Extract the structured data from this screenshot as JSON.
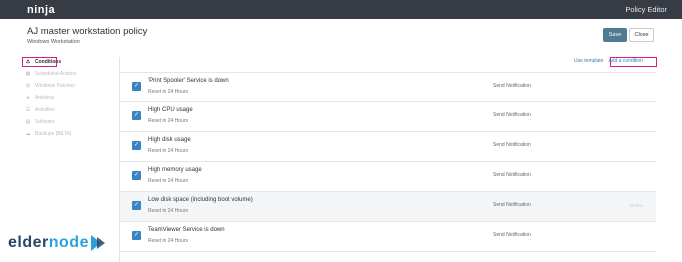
{
  "topbar": {
    "logo": "ninja",
    "title": "Policy Editor"
  },
  "header": {
    "title": "AJ master workstation policy",
    "subtitle": "Windows Workstation"
  },
  "buttons": {
    "save": "Save",
    "close": "Close"
  },
  "sidebar": {
    "items": [
      {
        "label": "Conditions",
        "icon": "warning-icon",
        "active": true
      },
      {
        "label": "Scheduled Actions",
        "icon": "calendar-icon",
        "active": false
      },
      {
        "label": "Windows Patches",
        "icon": "windows-icon",
        "active": false
      },
      {
        "label": "Antivirus",
        "icon": "shield-icon",
        "active": false
      },
      {
        "label": "Activities",
        "icon": "list-icon",
        "active": false
      },
      {
        "label": "Software",
        "icon": "grid-icon",
        "active": false
      },
      {
        "label": "Backups (BETA)",
        "icon": "cloud-icon",
        "active": false
      }
    ]
  },
  "links": {
    "use_template": "Use template",
    "add_condition": "Add a condition"
  },
  "conditions": [
    {
      "title": "'Print Spooler' Service is down",
      "reset": "Reset in 24 Hours",
      "action": "Send Notification"
    },
    {
      "title": "High CPU usage",
      "reset": "Reset in 24 Hours",
      "action": "Send Notification"
    },
    {
      "title": "High disk usage",
      "reset": "Reset in 24 Hours",
      "action": "Send Notification"
    },
    {
      "title": "High memory usage",
      "reset": "Reset in 24 Hours",
      "action": "Send Notification"
    },
    {
      "title": "Low disk space (including boot volume)",
      "reset": "Reset in 24 Hours",
      "action": "Send Notification",
      "delete": "Delete"
    },
    {
      "title": "TeamViewer Service is down",
      "reset": "Reset in 24 Hours",
      "action": "Send Notification"
    }
  ],
  "watermark": {
    "part1": "elder",
    "part2": "node"
  },
  "colors": {
    "topbar": "#363b44",
    "accent": "#3a84c4",
    "save": "#4f7c93",
    "highlight": "#d81b8a"
  }
}
